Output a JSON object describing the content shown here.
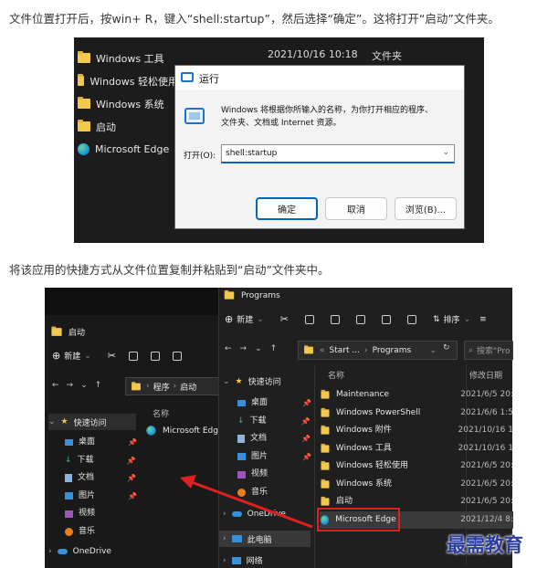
{
  "para1": "文件位置打开后，按win+ R，键入“shell:startup”，然后选择“确定”。这将打开“启动”文件夹。",
  "para2": "将该应用的快捷方式从文件位置复制并粘贴到“启动”文件夹中。",
  "shot1": {
    "list": [
      {
        "name": "Windows 工具",
        "icon": "folder-icon"
      },
      {
        "name": "Windows 轻松使用",
        "icon": "folder-icon"
      },
      {
        "name": "Windows 系统",
        "icon": "folder-icon"
      },
      {
        "name": "启动",
        "icon": "folder-icon"
      },
      {
        "name": "Microsoft Edge",
        "icon": "edge-icon"
      }
    ],
    "top_date": "2021/10/16 10:18",
    "top_type": "文件夹",
    "run": {
      "title": "运行",
      "desc_line1": "Windows 将根据你所输入的名称，为你打开相应的程序、",
      "desc_line2": "文件夹、文档或 Internet 资源。",
      "open_label": "打开(O):",
      "open_value": "shell:startup",
      "ok": "确定",
      "cancel": "取消",
      "browse": "浏览(B)..."
    }
  },
  "shot2": {
    "left": {
      "title": "启动",
      "new_label": "新建",
      "breadcrumb_a": "程序",
      "breadcrumb_b": "启动",
      "col_name": "名称",
      "file": "Microsoft Edge",
      "quick": "快速访问",
      "nav": [
        "桌面",
        "下载",
        "文档",
        "图片",
        "视频",
        "音乐"
      ],
      "onedrive": "OneDrive"
    },
    "right": {
      "title": "Programs",
      "new_label": "新建",
      "sort_label": "排序",
      "path_a": "Start ...",
      "path_b": "Programs",
      "search_placeholder": "搜索\"Pro",
      "quick": "快速访问",
      "nav": [
        "桌面",
        "下载",
        "文档",
        "图片",
        "视频",
        "音乐"
      ],
      "onedrive": "OneDrive",
      "this_pc": "此电脑",
      "network": "网络",
      "col_name": "名称",
      "col_date": "修改日期",
      "files": [
        {
          "name": "Maintenance",
          "date": "2021/6/5 20:"
        },
        {
          "name": "Windows PowerShell",
          "date": "2021/6/6 1:5"
        },
        {
          "name": "Windows 附件",
          "date": "2021/10/16 1"
        },
        {
          "name": "Windows 工具",
          "date": "2021/10/16 1"
        },
        {
          "name": "Windows 轻松使用",
          "date": "2021/6/5 20:"
        },
        {
          "name": "Windows 系统",
          "date": "2021/6/5 20:"
        },
        {
          "name": "启动",
          "date": "2021/6/5 20:"
        },
        {
          "name": "Microsoft Edge",
          "date": "2021/12/4 8:"
        }
      ]
    },
    "watermark": "最需教育"
  },
  "colors": {
    "accent": "#0067c0",
    "dark_bg": "#1c1c1c",
    "highlight_box": "#e02020"
  }
}
